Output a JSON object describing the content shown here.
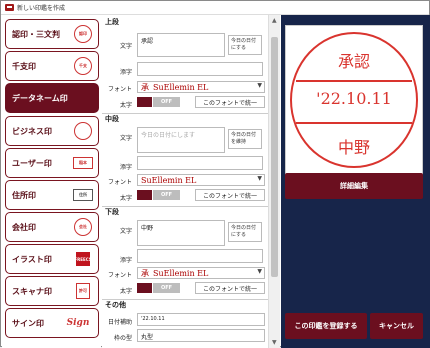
{
  "window": {
    "title": "新しい印鑑を作成"
  },
  "tabs": [
    {
      "label": "認印・三文判",
      "thumb": "認印",
      "kind": "circle"
    },
    {
      "label": "千支印",
      "thumb": "千支",
      "kind": "circle"
    },
    {
      "label": "データネーム印",
      "thumb": "",
      "kind": "none"
    },
    {
      "label": "ビジネス印",
      "thumb": "",
      "kind": "circle"
    },
    {
      "label": "ユーザー印",
      "thumb": "稲本",
      "kind": "box"
    },
    {
      "label": "住所印",
      "thumb": "住所",
      "kind": "box"
    },
    {
      "label": "会社印",
      "thumb": "会社",
      "kind": "circle"
    },
    {
      "label": "イラスト印",
      "thumb": "FREECS",
      "kind": "red"
    },
    {
      "label": "スキャナ印",
      "thumb": "許可",
      "kind": "box"
    },
    {
      "label": "サイン印",
      "thumb": "Sign",
      "kind": "sign"
    }
  ],
  "sections": {
    "top": {
      "header": "上段",
      "text_label": "文字",
      "text_value": "承認",
      "update_label": "今日の日付にする",
      "second_label": "添字",
      "second_value": "",
      "font_label": "フォント",
      "font_glyph": "承",
      "font_name": "SuEllemin EL",
      "color_label": "太字",
      "toggle": "OFF",
      "unify": "このフォントで統一"
    },
    "middle": {
      "header": "中段",
      "text_label": "文字",
      "text_value": "今日の日付にします",
      "update_label": "今日の日付を維持",
      "second_label": "添字",
      "second_value": "",
      "font_label": "フォント",
      "font_glyph": "",
      "font_name": "SuEllemin EL",
      "color_label": "太字",
      "toggle": "OFF",
      "unify": "このフォントで統一"
    },
    "bottom": {
      "header": "下段",
      "text_label": "文字",
      "text_value": "中野",
      "update_label": "今日の日付にする",
      "second_label": "添字",
      "second_value": "",
      "font_label": "フォント",
      "font_glyph": "承",
      "font_name": "SuEllemin EL",
      "color_label": "太字",
      "toggle": "OFF",
      "unify": "このフォントで統一"
    },
    "other": {
      "header": "その他",
      "date_label": "日付補助",
      "date_value": "'22.10.11",
      "frame_label": "枠の型",
      "frame_value": "丸型"
    }
  },
  "preview": {
    "top": "承認",
    "mid": "'22.10.11",
    "bot": "中野"
  },
  "buttons": {
    "edit": "詳細編集",
    "register": "この印鑑を登録する",
    "cancel": "キャンセル"
  },
  "colors": {
    "accent": "#6b0f1f",
    "stamp": "#d9342e",
    "panel": "#17254a"
  }
}
